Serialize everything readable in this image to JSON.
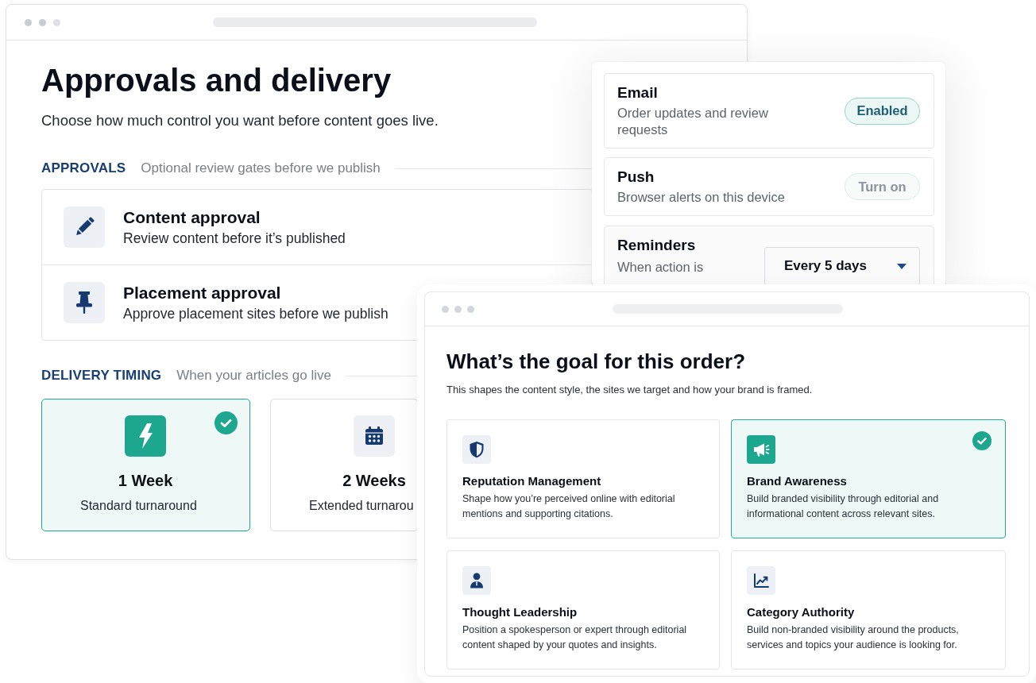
{
  "approvals_window": {
    "title": "Approvals and delivery",
    "subtitle": "Choose how much control you want before content goes live.",
    "approvals": {
      "label": "APPROVALS",
      "description": "Optional review gates before we publish",
      "items": [
        {
          "title": "Content approval",
          "description": "Review content before it’s published"
        },
        {
          "title": "Placement approval",
          "description": "Approve placement sites before we publish"
        }
      ]
    },
    "delivery_timing": {
      "label": "DELIVERY TIMING",
      "description": "When your articles go live",
      "options": [
        {
          "title": "1 Week",
          "description": "Standard turnaround",
          "selected": true
        },
        {
          "title": "2 Weeks",
          "description": "Extended turnarou",
          "selected": false
        }
      ]
    }
  },
  "notifications_panel": {
    "items": [
      {
        "kind": "toggle",
        "title": "Email",
        "description": "Order updates and review requests",
        "enabled": true,
        "button": "Enabled"
      },
      {
        "kind": "toggle",
        "title": "Push",
        "description": "Browser alerts on this device",
        "enabled": false,
        "button": "Turn on"
      },
      {
        "kind": "select",
        "title": "Reminders",
        "description": "When action is",
        "value": "Every 5 days"
      }
    ]
  },
  "goal_window": {
    "title": "What’s the goal for this order?",
    "subtitle": "This shapes the content style, the sites we target and how your brand is framed.",
    "options": [
      {
        "title": "Reputation Management",
        "description": "Shape how you’re perceived online with editorial mentions and supporting citations.",
        "selected": false
      },
      {
        "title": "Brand Awareness",
        "description": "Build branded visibility through editorial and informational content across relevant sites.",
        "selected": true
      },
      {
        "title": "Thought Leadership",
        "description": "Position a spokesperson or expert through editorial content shaped by your quotes and insights.",
        "selected": false
      },
      {
        "title": "Category Authority",
        "description": "Build non-branded visibility around the products, services and topics your audience is looking for.",
        "selected": false
      }
    ]
  }
}
